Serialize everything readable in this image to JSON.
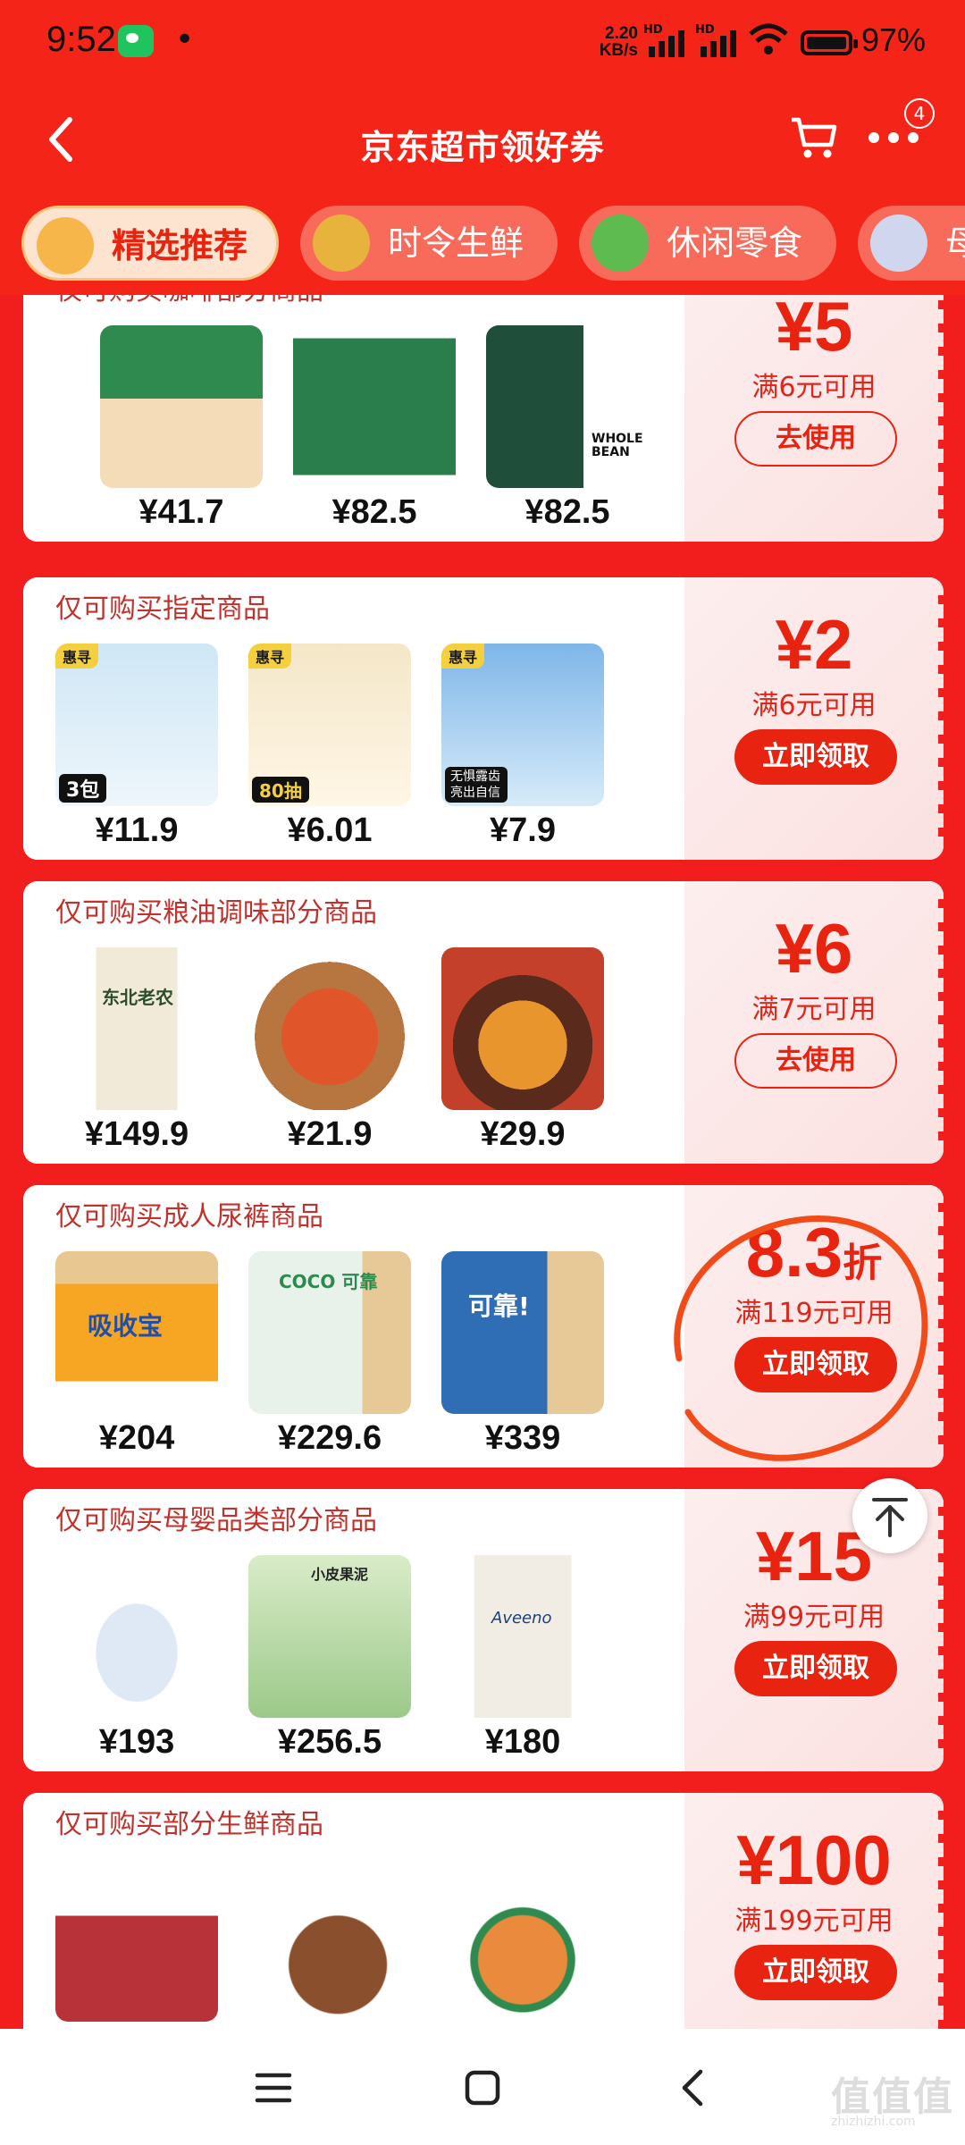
{
  "status": {
    "time": "9:52",
    "dot": "•",
    "net_speed": "2.20",
    "net_unit": "KB/s",
    "hd1": "HD",
    "hd2": "HD",
    "battery": "97%"
  },
  "navbar": {
    "title": "京东超市领好券",
    "badge": "4"
  },
  "tabs": [
    {
      "label": "精选推荐",
      "active": true
    },
    {
      "label": "时令生鲜"
    },
    {
      "label": "休闲零食"
    },
    {
      "label": "母"
    }
  ],
  "cards": [
    {
      "header": "仅可购买咖啡部分商品",
      "prices": [
        "¥41.7",
        "¥82.5",
        "¥82.5"
      ],
      "product_text": [
        "",
        "",
        "WHOLE BEAN"
      ],
      "amount": "¥5",
      "amount_suffix": "",
      "condition": "满6元可用",
      "button": "去使用"
    },
    {
      "header": "仅可购买指定商品",
      "prices": [
        "¥11.9",
        "¥6.01",
        "¥7.9"
      ],
      "product_tags": [
        "惠寻",
        "惠寻",
        "惠寻"
      ],
      "product_text": [
        "3包",
        "80抽",
        "无惧露齿 亮出自信"
      ],
      "amount": "¥2",
      "amount_suffix": "",
      "condition": "满6元可用",
      "button": "立即领取"
    },
    {
      "header": "仅可购买粮油调味部分商品",
      "prices": [
        "¥149.9",
        "¥21.9",
        "¥29.9"
      ],
      "product_text": [
        "东北老农",
        "",
        ""
      ],
      "amount": "¥6",
      "amount_suffix": "",
      "condition": "满7元可用",
      "button": "去使用"
    },
    {
      "header": "仅可购买成人尿裤商品",
      "prices": [
        "¥204",
        "¥229.6",
        "¥339"
      ],
      "product_text": [
        "吸收宝",
        "COCO 可靠",
        "可靠!"
      ],
      "amount": "8.3",
      "amount_suffix": "折",
      "condition": "满119元可用",
      "button": "立即领取"
    },
    {
      "header": "仅可购买母婴品类部分商品",
      "prices": [
        "¥193",
        "¥256.5",
        "¥180"
      ],
      "product_text": [
        "",
        "小皮果泥",
        "Aveeno"
      ],
      "amount": "¥15",
      "amount_suffix": "",
      "condition": "满99元可用",
      "button": "立即领取"
    },
    {
      "header": "仅可购买部分生鲜商品",
      "prices": [
        "",
        "",
        ""
      ],
      "product_text": [
        "",
        "",
        ""
      ],
      "amount": "¥100",
      "amount_suffix": "",
      "condition": "满199元可用",
      "button": "立即领取"
    }
  ],
  "watermark": {
    "mark": "值值值",
    "site": "zhizhizhi.com"
  },
  "colors": {
    "brand_red": "#f21d1d",
    "coupon_red": "#e8230f"
  }
}
